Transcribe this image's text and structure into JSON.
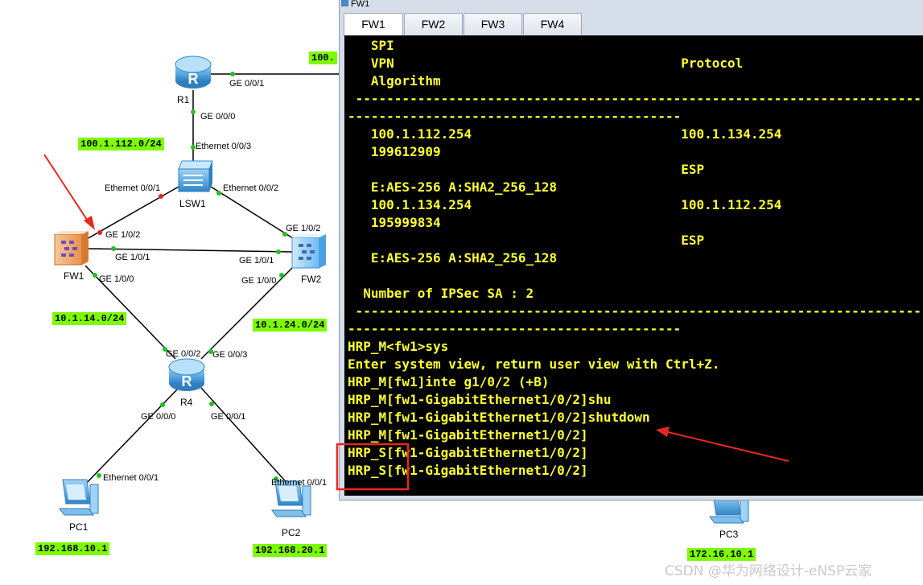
{
  "window": {
    "title": "FW1",
    "tabs": [
      {
        "label": "FW1",
        "active": true
      },
      {
        "label": "FW2",
        "active": false
      },
      {
        "label": "FW3",
        "active": false
      },
      {
        "label": "FW4",
        "active": false
      }
    ]
  },
  "console": {
    "lines": [
      "   SPI",
      "   VPN                                     Protocol",
      "   Algorithm",
      " ------------------------------------------------------------------------------",
      "-------------------------------------------",
      "   100.1.112.254                           100.1.134.254",
      "   199612909",
      "                                           ESP",
      "   E:AES-256 A:SHA2_256_128",
      "   100.1.134.254                           100.1.112.254",
      "   195999834",
      "                                           ESP",
      "   E:AES-256 A:SHA2_256_128",
      "",
      "  Number of IPSec SA : 2",
      " ------------------------------------------------------------------------------",
      "-------------------------------------------",
      "HRP_M<fw1>sys",
      "Enter system view, return user view with Ctrl+Z.",
      "HRP_M[fw1]inte g1/0/2 (+B)",
      "HRP_M[fw1-GigabitEthernet1/0/2]shu",
      "HRP_M[fw1-GigabitEthernet1/0/2]shutdown",
      "HRP_M[fw1-GigabitEthernet1/0/2]",
      "HRP_S[fw1-GigabitEthernet1/0/2]",
      "HRP_S[fw1-GigabitEthernet1/0/2]"
    ]
  },
  "devices": {
    "r1": "R1",
    "lsw1": "LSW1",
    "fw1": "FW1",
    "fw2": "FW2",
    "r4": "R4",
    "pc1": "PC1",
    "pc2": "PC2",
    "pc3": "PC3"
  },
  "interfaces": {
    "r1_ge001": "GE 0/0/1",
    "r1_ge000": "GE 0/0/0",
    "lsw1_e003": "Ethernet 0/0/3",
    "lsw1_e001": "Ethernet 0/0/1",
    "lsw1_e002": "Ethernet 0/0/2",
    "fw1_ge102": "GE 1/0/2",
    "fw1_ge101": "GE 1/0/1",
    "fw1_ge100": "GE 1/0/0",
    "fw2_ge102": "GE 1/0/2",
    "fw2_ge101": "GE 1/0/1",
    "fw2_ge100": "GE 1/0/0",
    "r4_ge002": "GE 0/0/2",
    "r4_ge003": "GE 0/0/3",
    "r4_ge000": "GE 0/0/0",
    "r4_ge001": "GE 0/0/1",
    "pc1_e001": "Ethernet 0/0/1",
    "pc2_e001": "Ethernet 0/0/1"
  },
  "networks": {
    "n100_112": "100.1.112.0/24",
    "n100_partial": "100.",
    "n10_14": "10.1.14.0/24",
    "n10_24": "10.1.24.0/24",
    "pc1_ip": "192.168.10.1",
    "pc2_ip": "192.168.20.1",
    "pc3_ip": "172.16.10.1"
  },
  "watermark": "CSDN @华为网络设计-eNSP云家",
  "colors": {
    "console_bg": "#000000",
    "console_text": "#ffff33",
    "net_label_bg": "#7CFC00",
    "annotation_red": "#e8281e",
    "link_dot_green": "#22c022",
    "link_dot_red": "#e82020"
  }
}
